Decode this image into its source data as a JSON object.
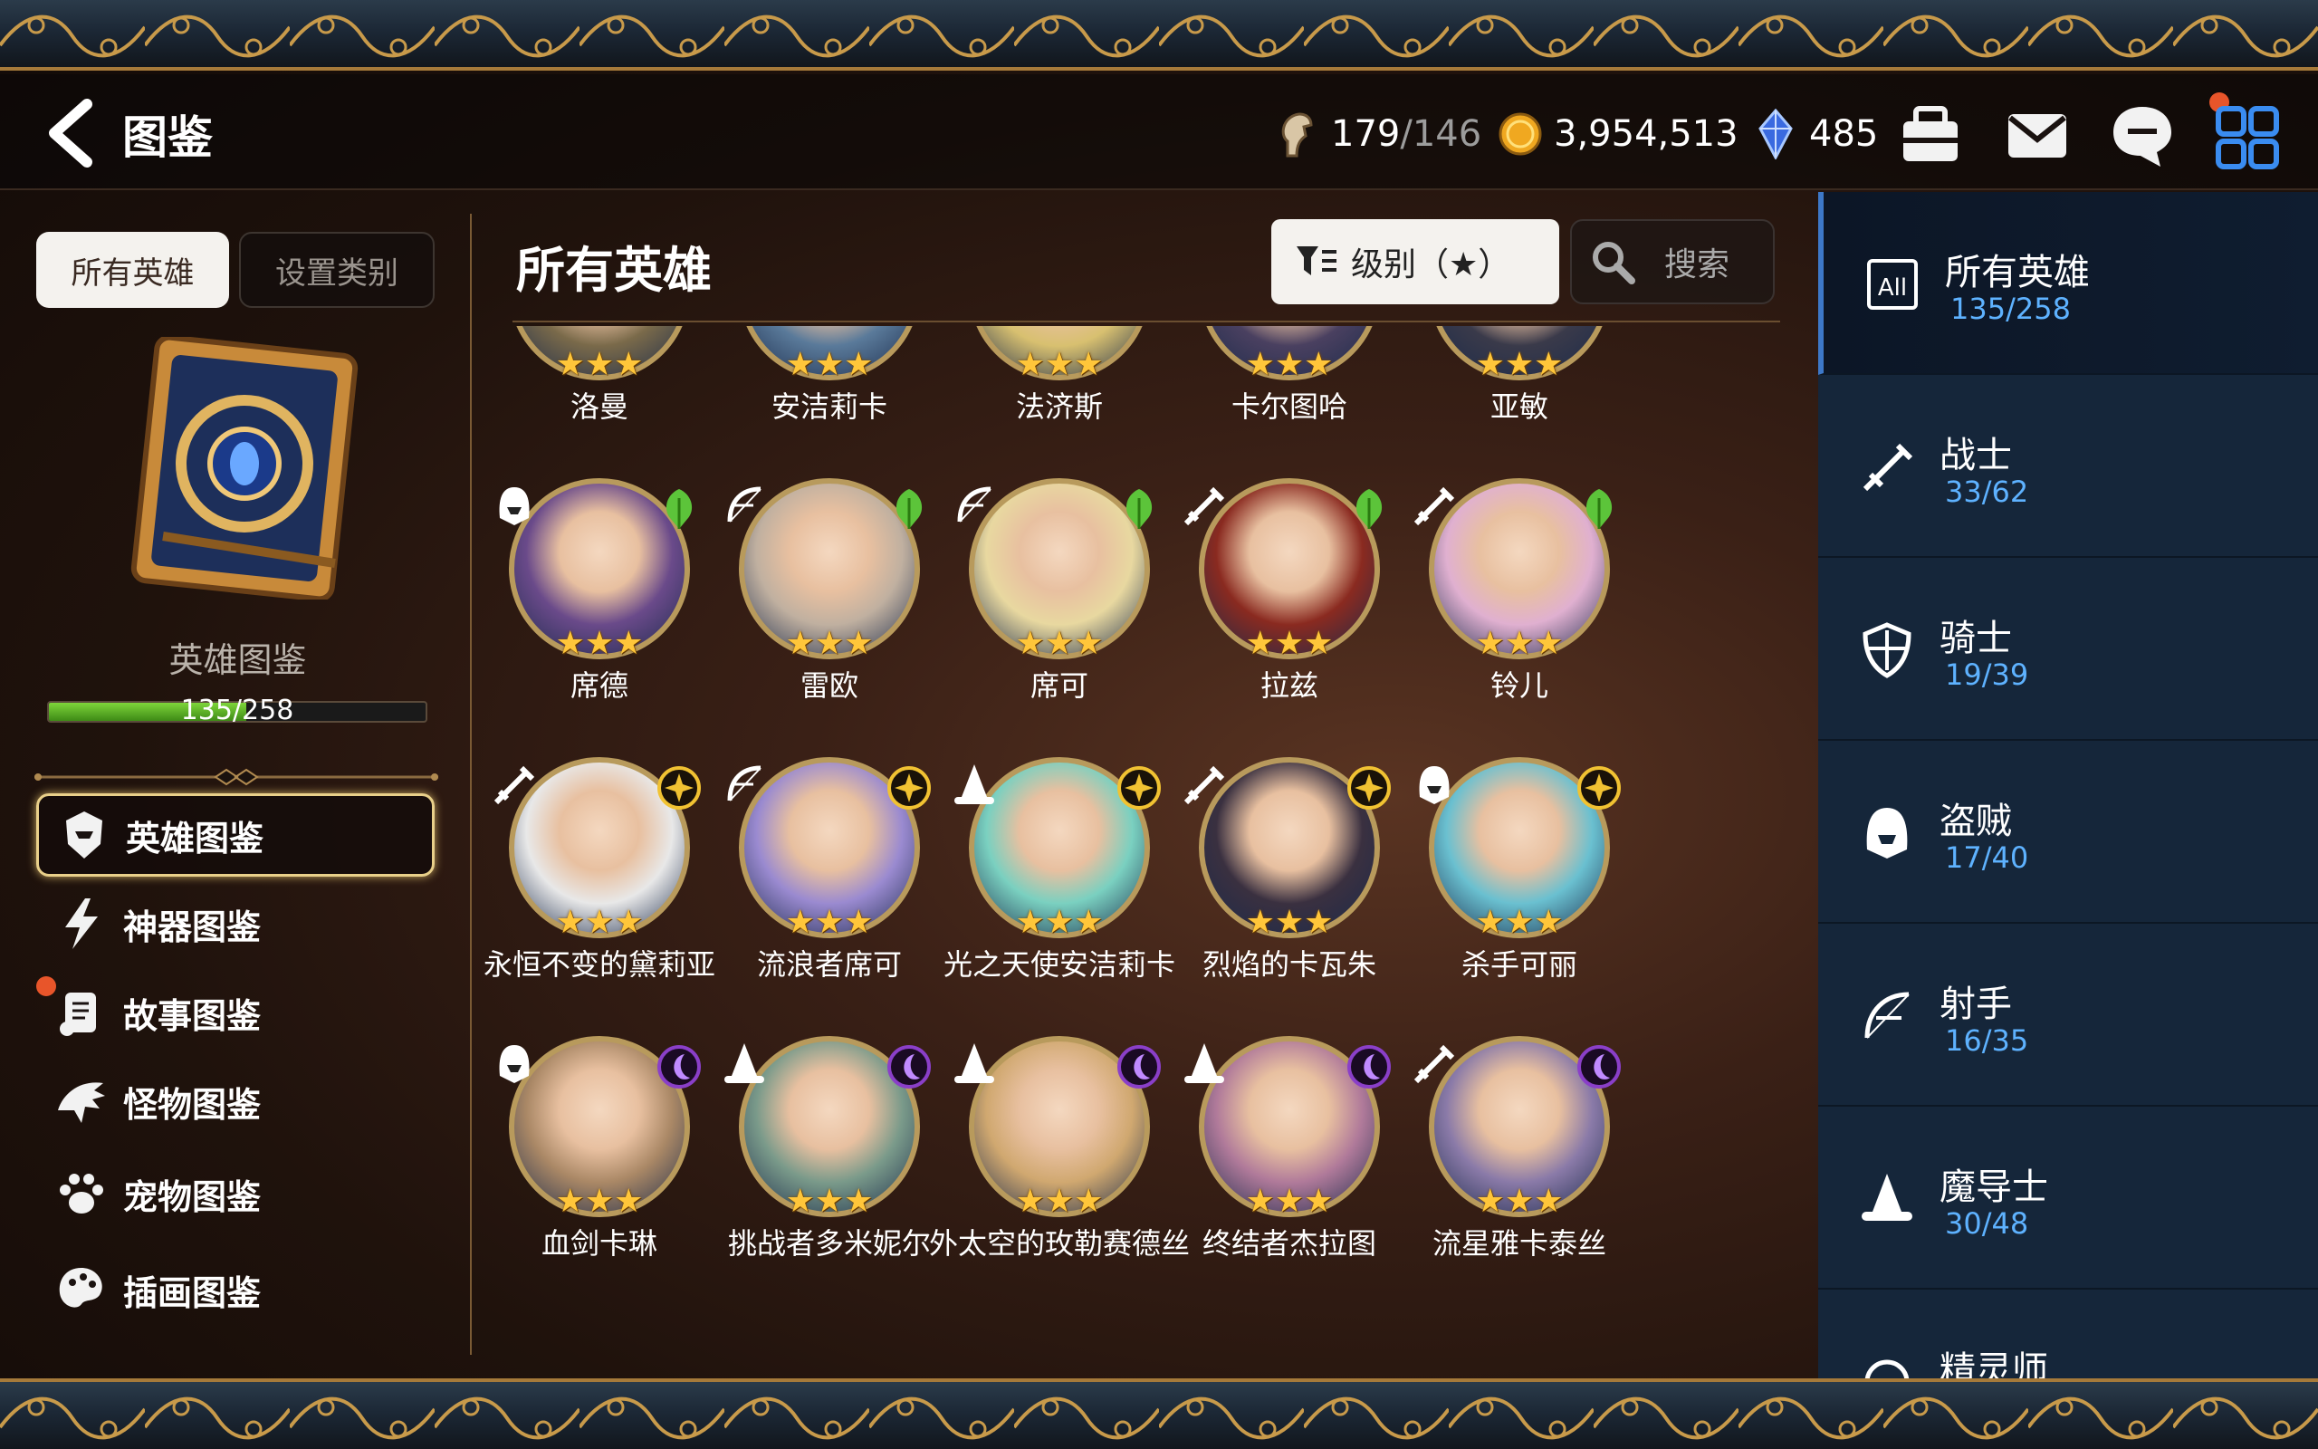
{
  "header": {
    "title": "图鉴",
    "hero_slots": {
      "value": "179",
      "max": "/146"
    },
    "gold": "3,954,513",
    "crystals": "485"
  },
  "left": {
    "tab_all": "所有英雄",
    "tab_settings": "设置类别",
    "book_label": "英雄图鉴",
    "progress_text": "135/258",
    "progress": 0.523,
    "nav": [
      {
        "label": "英雄图鉴",
        "icon": "hero-helmet-icon",
        "active": true
      },
      {
        "label": "神器图鉴",
        "icon": "lightning-icon",
        "active": false
      },
      {
        "label": "故事图鉴",
        "icon": "scroll-icon",
        "active": false,
        "badge": true
      },
      {
        "label": "怪物图鉴",
        "icon": "dragon-icon",
        "active": false
      },
      {
        "label": "宠物图鉴",
        "icon": "paw-icon",
        "active": false
      },
      {
        "label": "插画图鉴",
        "icon": "palette-icon",
        "active": false
      }
    ]
  },
  "center": {
    "title": "所有英雄",
    "sort_label": "级别（★）",
    "search_label": "搜索",
    "rows": [
      [
        "洛曼",
        "安洁莉卡",
        "法济斯",
        "卡尔图哈",
        "亚敏"
      ],
      [
        "席德",
        "雷欧",
        "席可",
        "拉兹",
        "铃儿"
      ],
      [
        "永恒不变的黛莉亚",
        "流浪者席可",
        "光之天使安洁莉卡",
        "烈焰的卡瓦朱",
        "杀手可丽"
      ],
      [
        "血剑卡琳",
        "挑战者多米妮尔",
        "外太空的玫勒赛德丝",
        "终结者杰拉图",
        "流星雅卡泰丝"
      ]
    ],
    "row_elements": [
      "none",
      "earth",
      "light",
      "dark"
    ],
    "classes": [
      [
        "",
        "",
        "",
        "",
        ""
      ],
      [
        "thief",
        "archer",
        "archer",
        "warrior",
        "warrior"
      ],
      [
        "warrior",
        "archer",
        "mage",
        "warrior",
        "thief"
      ],
      [
        "thief",
        "mage",
        "mage",
        "mage",
        "warrior"
      ]
    ],
    "stars": "★★★"
  },
  "right": {
    "categories": [
      {
        "name": "所有英雄",
        "count": "135/258",
        "icon": "all-icon"
      },
      {
        "name": "战士",
        "count": "33/62",
        "icon": "sword-icon"
      },
      {
        "name": "骑士",
        "count": "19/39",
        "icon": "shield-icon"
      },
      {
        "name": "盗贼",
        "count": "17/40",
        "icon": "hood-icon"
      },
      {
        "name": "射手",
        "count": "16/35",
        "icon": "bow-icon"
      },
      {
        "name": "魔导士",
        "count": "30/48",
        "icon": "wizard-hat-icon"
      },
      {
        "name": "精灵师",
        "count": "",
        "icon": "spirit-icon"
      }
    ]
  },
  "colors": {
    "accent": "#3d78c8",
    "count_blue": "#5eb2ff",
    "gold": "#ffc63a",
    "earth": "#5cc43a",
    "light": "#f1c232",
    "dark": "#8a3fc8"
  }
}
